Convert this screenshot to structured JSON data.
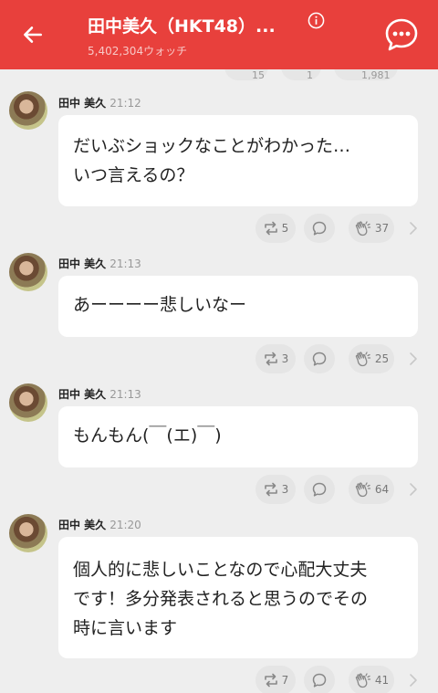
{
  "header": {
    "title": "田中美久（HKT48）...",
    "watch_count": "5,402,304ウォッチ"
  },
  "ghost_counts": {
    "retweet": "15",
    "reply": "1",
    "like": "1,981"
  },
  "posts": [
    {
      "name": "田中 美久",
      "time": "21:12",
      "text": "だいぶショックなことがわかった…\nいつ言えるの？",
      "retweets": "5",
      "likes": "37"
    },
    {
      "name": "田中 美久",
      "time": "21:13",
      "text": "あーーーー悲しいなー",
      "retweets": "3",
      "likes": "25"
    },
    {
      "name": "田中 美久",
      "time": "21:13",
      "text": "もんもん(￣(エ)￣)",
      "retweets": "3",
      "likes": "64"
    },
    {
      "name": "田中 美久",
      "time": "21:20",
      "text": "個人的に悲しいことなので心配大丈夫\nです！多分発表されると思うのでその\n時に言います",
      "retweets": "7",
      "likes": "41"
    }
  ],
  "colors": {
    "accent": "#e8403c",
    "background": "#eeeeee",
    "bubble": "#ffffff"
  },
  "icons": {
    "back": "arrow-left-icon",
    "info": "info-icon",
    "chat": "chat-bubble-icon",
    "retweet": "retweet-icon",
    "reply": "reply-icon",
    "like": "clap-icon",
    "more": "chevron-right-icon"
  }
}
